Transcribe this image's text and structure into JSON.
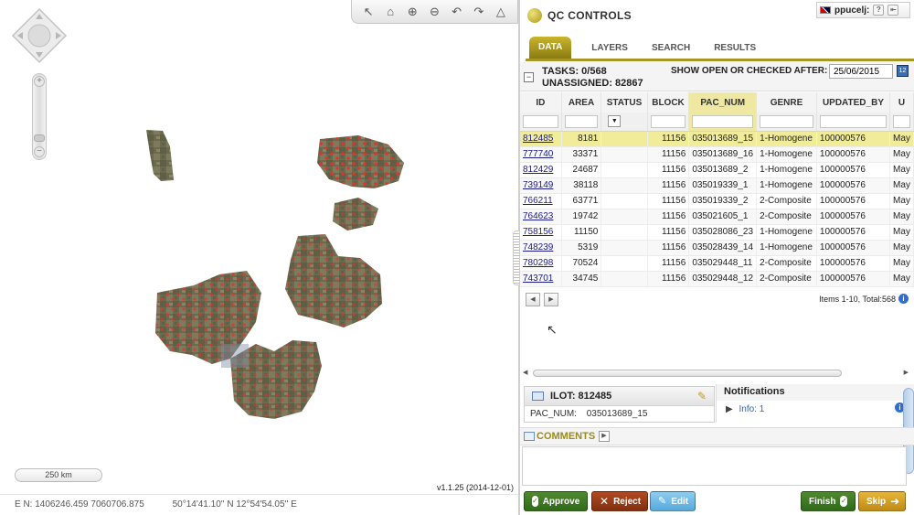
{
  "map": {
    "scale_label": "250 km",
    "version": "v1.1.25 (2014-12-01)",
    "coords": {
      "en": "E N: 1406246.459 7060706.875",
      "latlon": "50°14'41.10'' N 12°54'54.05'' E"
    },
    "tools": [
      "select-icon",
      "home-icon",
      "zoom-in-icon",
      "zoom-out-icon",
      "pan-back-icon",
      "pan-forward-icon",
      "measure-icon"
    ]
  },
  "header": {
    "brand": "QC CONTROLS",
    "user": "ppucelj:"
  },
  "tabs": [
    {
      "label": "DATA",
      "active": true
    },
    {
      "label": "LAYERS",
      "active": false
    },
    {
      "label": "SEARCH",
      "active": false
    },
    {
      "label": "RESULTS",
      "active": false
    }
  ],
  "tasks": {
    "tasks_line": "TASKS: 0/568",
    "unassigned_line": "UNASSIGNED: 82867",
    "show_after_label": "SHOW OPEN OR CHECKED AFTER:",
    "date_value": "25/06/2015"
  },
  "grid": {
    "columns": [
      "ID",
      "AREA",
      "STATUS",
      "BLOCK",
      "PAC_NUM",
      "GENRE",
      "UPDATED_BY",
      "U"
    ],
    "rows": [
      {
        "id": "812485",
        "area": "8181",
        "status": "",
        "block": "11156",
        "pac": "035013689_15",
        "genre": "1-Homogene",
        "updated_by": "100000576",
        "u": "May",
        "selected": true
      },
      {
        "id": "777740",
        "area": "33371",
        "status": "",
        "block": "11156",
        "pac": "035013689_16",
        "genre": "1-Homogene",
        "updated_by": "100000576",
        "u": "May",
        "selected": false
      },
      {
        "id": "812429",
        "area": "24687",
        "status": "",
        "block": "11156",
        "pac": "035013689_2",
        "genre": "1-Homogene",
        "updated_by": "100000576",
        "u": "May",
        "selected": false
      },
      {
        "id": "739149",
        "area": "38118",
        "status": "",
        "block": "11156",
        "pac": "035019339_1",
        "genre": "1-Homogene",
        "updated_by": "100000576",
        "u": "May",
        "selected": false
      },
      {
        "id": "766211",
        "area": "63771",
        "status": "",
        "block": "11156",
        "pac": "035019339_2",
        "genre": "2-Composite",
        "updated_by": "100000576",
        "u": "May",
        "selected": false
      },
      {
        "id": "764623",
        "area": "19742",
        "status": "",
        "block": "11156",
        "pac": "035021605_1",
        "genre": "2-Composite",
        "updated_by": "100000576",
        "u": "May",
        "selected": false
      },
      {
        "id": "758156",
        "area": "11150",
        "status": "",
        "block": "11156",
        "pac": "035028086_23",
        "genre": "1-Homogene",
        "updated_by": "100000576",
        "u": "May",
        "selected": false
      },
      {
        "id": "748239",
        "area": "5319",
        "status": "",
        "block": "11156",
        "pac": "035028439_14",
        "genre": "1-Homogene",
        "updated_by": "100000576",
        "u": "May",
        "selected": false
      },
      {
        "id": "780298",
        "area": "70524",
        "status": "",
        "block": "11156",
        "pac": "035029448_11",
        "genre": "2-Composite",
        "updated_by": "100000576",
        "u": "May",
        "selected": false
      },
      {
        "id": "743701",
        "area": "34745",
        "status": "",
        "block": "11156",
        "pac": "035029448_12",
        "genre": "2-Composite",
        "updated_by": "100000576",
        "u": "May",
        "selected": false
      }
    ],
    "items_count": "Items 1-10, Total:568"
  },
  "ilot": {
    "title": "ILOT: 812485",
    "field_label": "PAC_NUM:",
    "field_value": "035013689_15"
  },
  "notifications": {
    "title": "Notifications",
    "item": "Info: 1"
  },
  "comments": {
    "label": "COMMENTS"
  },
  "actions": {
    "approve": "Approve",
    "reject": "Reject",
    "edit": "Edit",
    "finish": "Finish",
    "skip": "Skip"
  },
  "colors": {
    "accent": "#a89723",
    "selected_row": "#f1ec9a",
    "approve": "#3a7a22",
    "reject": "#9b3a15",
    "edit": "#6dbbe6",
    "skip": "#d9a22a",
    "parcel_marker": "#e8302a"
  }
}
